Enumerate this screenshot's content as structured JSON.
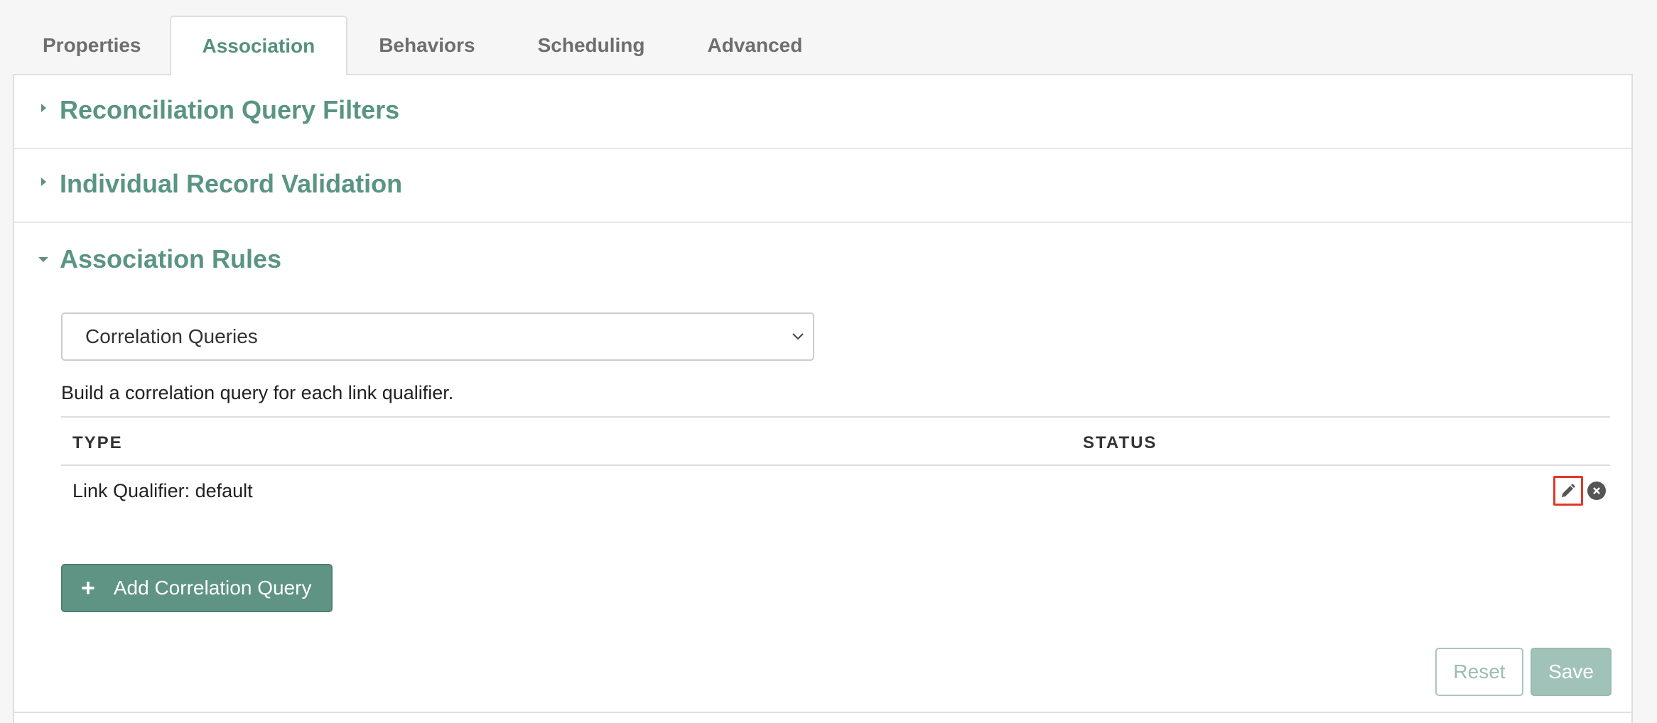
{
  "tabs": [
    {
      "label": "Properties"
    },
    {
      "label": "Association"
    },
    {
      "label": "Behaviors"
    },
    {
      "label": "Scheduling"
    },
    {
      "label": "Advanced"
    }
  ],
  "sections": {
    "reconciliation": {
      "title": "Reconciliation Query Filters"
    },
    "validation": {
      "title": "Individual Record Validation"
    },
    "rules": {
      "title": "Association Rules"
    }
  },
  "rules": {
    "select_value": "Correlation Queries",
    "helper_text": "Build a correlation query for each link qualifier.",
    "table": {
      "headers": {
        "type": "TYPE",
        "status": "STATUS"
      },
      "rows": [
        {
          "type": "Link Qualifier: default",
          "status": ""
        }
      ]
    },
    "add_label": "Add Correlation Query",
    "reset_label": "Reset",
    "save_label": "Save"
  },
  "icons": {
    "edit": "pencil-icon",
    "remove": "close-circle-icon",
    "add": "plus-icon",
    "select": "chevron-down-icon"
  },
  "colors": {
    "accent": "#5a9482",
    "primary_button": "#5f9383",
    "highlight": "#e0382b"
  }
}
